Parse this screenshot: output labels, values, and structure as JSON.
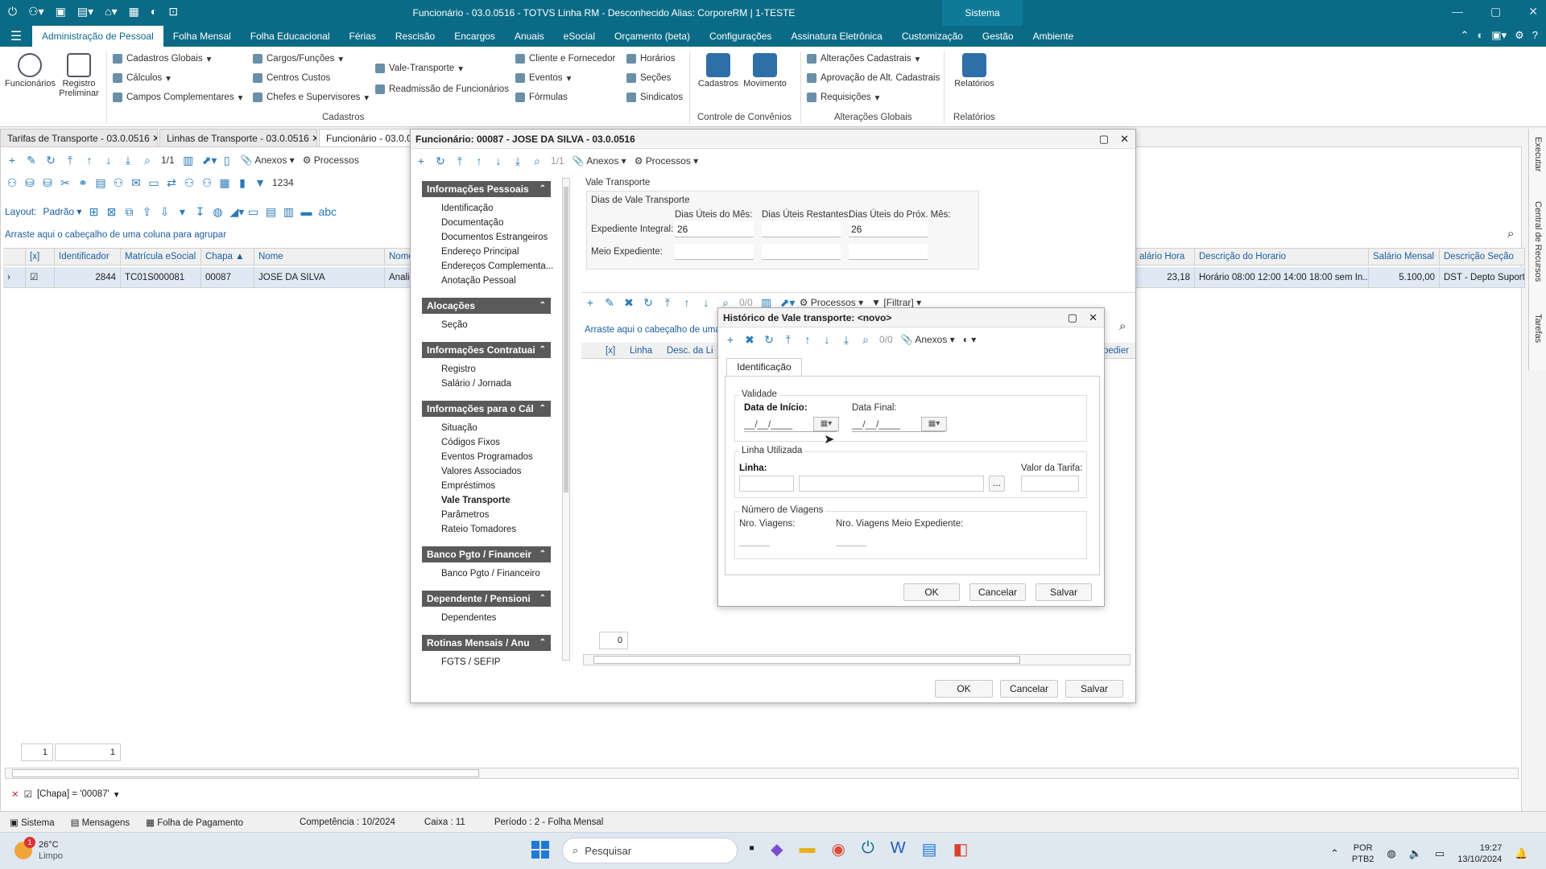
{
  "window": {
    "title": "Funcionário - 03.0.0516 - TOTVS Linha RM - Desconhecido  Alias: CorporeRM | 1-TESTE",
    "system_label": "Sistema"
  },
  "menu": {
    "tabs": [
      "Administração de Pessoal",
      "Folha Mensal",
      "Folha Educacional",
      "Férias",
      "Rescisão",
      "Encargos",
      "Anuais",
      "eSocial",
      "Orçamento (beta)",
      "Configurações",
      "Assinatura Eletrônica",
      "Customização",
      "Gestão",
      "Ambiente"
    ],
    "active": 0
  },
  "ribbon": {
    "big_buttons": [
      {
        "label": "Funcionários"
      },
      {
        "label": "Registro Preliminar"
      },
      {
        "label": "Cadastros"
      },
      {
        "label": "Movimento"
      },
      {
        "label": "Relatórios"
      }
    ],
    "col1": [
      "Cadastros Globais",
      "Cálculos",
      "Campos Complementares"
    ],
    "col2": [
      "Cargos/Funções",
      "Centros Custos",
      "Chefes e Supervisores"
    ],
    "col3": [
      "Vale-Transporte",
      "Readmissão de Funcionários"
    ],
    "col4": [
      "Cliente e Fornecedor",
      "Eventos",
      "Fórmulas"
    ],
    "col5": [
      "Horários",
      "Seções",
      "Sindicatos"
    ],
    "col6": [
      "Alterações Cadastrais",
      "Aprovação de Alt. Cadastrais",
      "Requisições"
    ],
    "groups": [
      "Cadastros",
      "Controle de Convênios",
      "Alterações Globais",
      "Relatórios"
    ]
  },
  "doc_tabs": [
    "Tarifas de Transporte - 03.0.0516",
    "Linhas de Transporte - 03.0.0516",
    "Funcionário - 03.0.051"
  ],
  "bg": {
    "anexos": "Anexos",
    "processos": "Processos",
    "counter": "1/1",
    "layout_label": "Layout:",
    "layout_value": "Padrão",
    "group_hint": "Arraste aqui o cabeçalho de uma coluna para agrupar",
    "columns_left": [
      "[x]",
      "Identificador",
      "Matrícula eSocial",
      "Chapa",
      "Nome",
      "Nome"
    ],
    "row_left": [
      "2844",
      "TC01S000081",
      "00087",
      "JOSE DA SILVA",
      "Anali"
    ],
    "columns_right": [
      "alário Hora",
      "Descrição do Horario",
      "Salário Mensal",
      "Descrição Seção"
    ],
    "row_right": [
      "23,18",
      "Horário 08:00 12:00 14:00 18:00 sem In...",
      "5.100,00",
      "DST - Depto Suporte"
    ],
    "pager": [
      "1",
      "1"
    ],
    "filter": "[Chapa] = '00087'",
    "num_label": "1234"
  },
  "statusbar": {
    "items": [
      "Sistema",
      "Mensagens",
      "Folha de Pagamento"
    ],
    "competencia": "Competência : 10/2024",
    "caixa": "Caixa : 11",
    "periodo": "Período : 2 - Folha Mensal"
  },
  "func_window": {
    "title": "Funcionário: 00087 - JOSE DA SILVA - 03.0.0516",
    "counter": "1/1",
    "anexos": "Anexos",
    "processos": "Processos",
    "nav": [
      {
        "title": "Informações Pessoais",
        "items": [
          "Identificação",
          "Documentação",
          "Documentos Estrangeiros",
          "Endereço Principal",
          "Endereços Complementa...",
          "Anotação Pessoal"
        ]
      },
      {
        "title": "Alocações",
        "items": [
          "Seção"
        ]
      },
      {
        "title": "Informações Contratuai",
        "items": [
          "Registro",
          "Salário / Jornada"
        ]
      },
      {
        "title": "Informações para o Cál",
        "items": [
          "Situação",
          "Códigos Fixos",
          "Eventos Programados",
          "Valores Associados",
          "Empréstimos",
          "Vale Transporte",
          "Parâmetros",
          "Rateio Tomadores"
        ]
      },
      {
        "title": "Banco Pgto / Financeir",
        "items": [
          "Banco Pgto / Financeiro"
        ]
      },
      {
        "title": "Dependente / Pensioni",
        "items": [
          "Dependentes"
        ]
      },
      {
        "title": "Rotinas Mensais / Anu",
        "items": [
          "FGTS / SEFIP"
        ]
      }
    ],
    "section_title": "Vale Transporte",
    "sub_title": "Dias de Vale Transporte",
    "col_labels": [
      "Dias Úteis do Mês:",
      "Dias Úteis Restantes:",
      "Dias Úteis do Próx. Mês:"
    ],
    "row_labels": [
      "Expediente Integral:",
      "Meio Expediente:"
    ],
    "integral_values": [
      "26",
      "",
      "26"
    ],
    "inner_counter": "0/0",
    "inner_processos": "Processos",
    "inner_filter": "[Filtrar]",
    "group_hint": "Arraste aqui o cabeçalho de uma c",
    "inner_columns": [
      "[x]",
      "Linha",
      "Desc. da Li"
    ],
    "inner_col_right": "pedier",
    "inner_count": "0",
    "buttons": [
      "OK",
      "Cancelar",
      "Salvar"
    ]
  },
  "hist_dialog": {
    "title": "Histórico de Vale transporte: <novo>",
    "counter": "0/0",
    "anexos": "Anexos",
    "tab": "Identificação",
    "validade": "Validade",
    "data_inicio": "Data de Início:",
    "data_final": "Data Final:",
    "date_placeholder": "__/__/____",
    "linha_utilizada": "Linha Utilizada",
    "linha": "Linha:",
    "valor_tarifa": "Valor da Tarifa:",
    "numero_viagens": "Número de Viagens",
    "nro_viagens": "Nro. Viagens:",
    "nro_viagens_meio": "Nro. Viagens Meio Expediente:",
    "ellipsis": "...",
    "buttons": [
      "OK",
      "Cancelar",
      "Salvar"
    ]
  },
  "sidebar_right": [
    "Executar",
    "Central de Recursos",
    "Tarefas"
  ],
  "taskbar": {
    "weather_temp": "26°C",
    "weather_desc": "Limpo",
    "search": "Pesquisar",
    "lang": "POR",
    "layout": "PTB2",
    "time": "19:27",
    "date": "13/10/2024",
    "notif": "1"
  }
}
